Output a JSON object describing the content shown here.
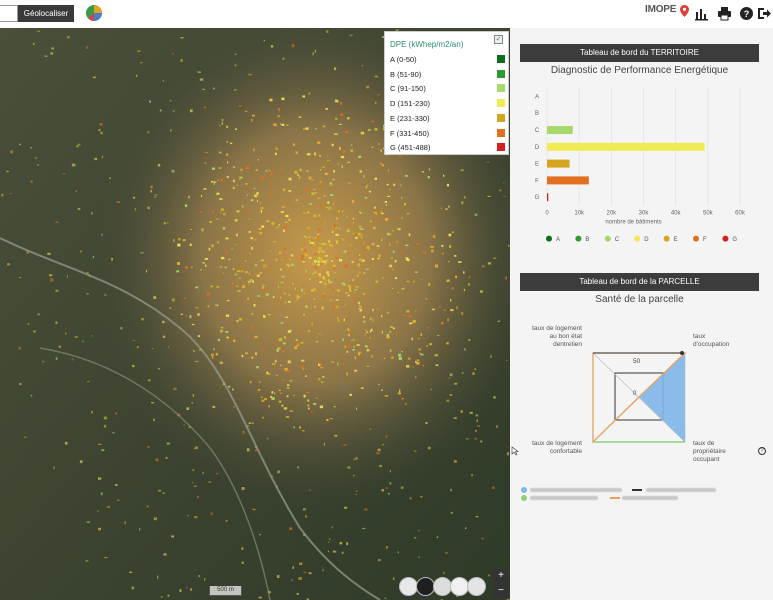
{
  "toolbar": {
    "search_value": "",
    "geolocate_label": "Géolocaliser",
    "logo_text": "IMOPE"
  },
  "map": {
    "legend": {
      "title": "DPE (kWhep/m2/an)",
      "classes": [
        {
          "label": "A (0-50)",
          "color": "#0b6e1f"
        },
        {
          "label": "B (51-90)",
          "color": "#2e9c2e"
        },
        {
          "label": "C (91-150)",
          "color": "#a6d96a"
        },
        {
          "label": "D (151-230)",
          "color": "#f0ea55"
        },
        {
          "label": "E (231-330)",
          "color": "#d6a520"
        },
        {
          "label": "F (331-450)",
          "color": "#e06f1f"
        },
        {
          "label": "G (451-488)",
          "color": "#d42020"
        }
      ]
    },
    "scale_label": "500 m",
    "zoom_in": "+",
    "zoom_out": "−"
  },
  "territory": {
    "header": "Tableau de bord du TERRITOIRE",
    "subtitle": "Diagnostic de Performance Energétique"
  },
  "parcel": {
    "header": "Tableau de bord de la PARCELLE",
    "subtitle": "Santé de la parcelle",
    "radar_labels": {
      "top_left": "taux de logement au bon état dentretien",
      "top_right": "taux d'occupation",
      "bottom_left": "taux de logement confortable",
      "bottom_right": "taux de propriétaire occupant"
    },
    "radar_ticks": [
      "50",
      "0"
    ]
  },
  "chart_data": {
    "type": "bar",
    "orientation": "horizontal",
    "categories": [
      "A",
      "B",
      "C",
      "D",
      "E",
      "F",
      "G"
    ],
    "values": [
      0,
      0,
      8000,
      49000,
      7000,
      13000,
      400
    ],
    "colors": [
      "#0b6e1f",
      "#2e9c2e",
      "#a6d96a",
      "#f0ea55",
      "#d6a520",
      "#e06f1f",
      "#d42020"
    ],
    "xlabel": "nombre de bâtiments",
    "xticks": [
      "0",
      "10k",
      "20k",
      "30k",
      "40k",
      "50k",
      "60k"
    ],
    "xlim": [
      0,
      60000
    ],
    "legend": [
      "A",
      "B",
      "C",
      "D",
      "E",
      "F",
      "G"
    ],
    "legend_placement": "bottom",
    "grid": true
  }
}
